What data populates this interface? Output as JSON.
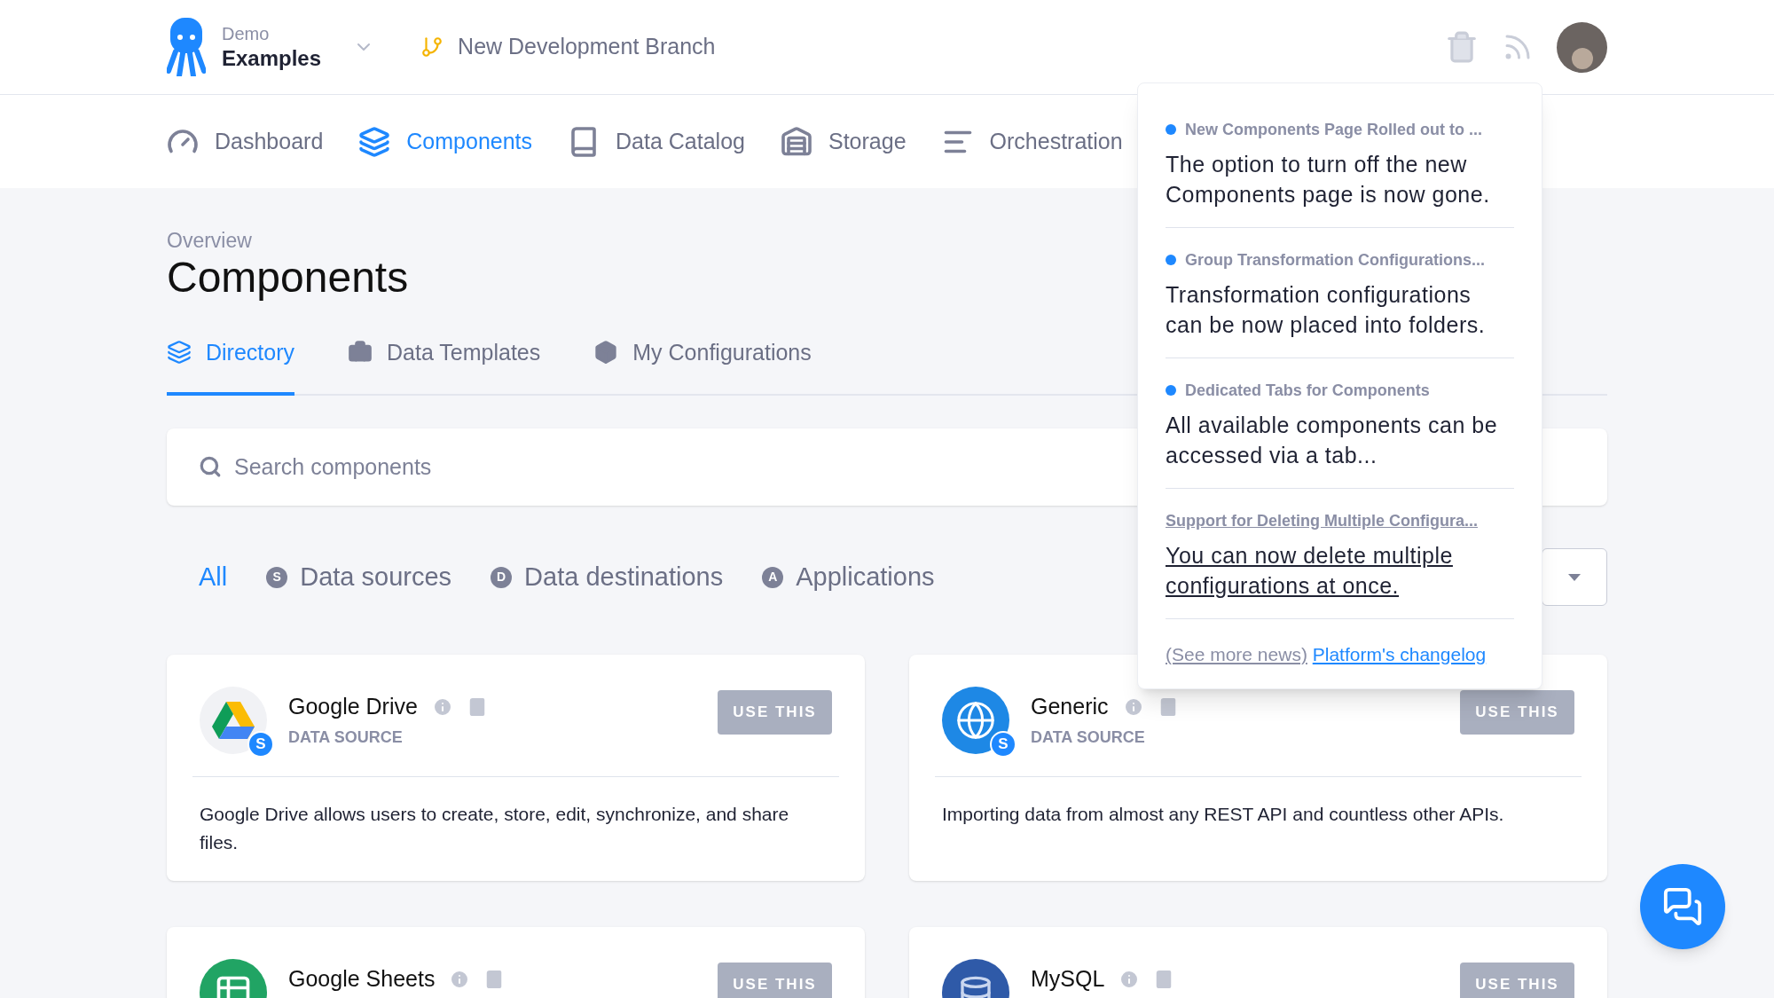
{
  "header": {
    "org": "Demo",
    "project": "Examples",
    "branch": "New Development Branch"
  },
  "nav": [
    {
      "label": "Dashboard",
      "selected": false
    },
    {
      "label": "Components",
      "selected": true
    },
    {
      "label": "Data Catalog",
      "selected": false
    },
    {
      "label": "Storage",
      "selected": false
    },
    {
      "label": "Orchestration",
      "selected": false
    }
  ],
  "page": {
    "breadcrumb": "Overview",
    "title": "Components"
  },
  "tabs": [
    {
      "label": "Directory",
      "selected": true
    },
    {
      "label": "Data Templates",
      "selected": false
    },
    {
      "label": "My Configurations",
      "selected": false
    }
  ],
  "search": {
    "placeholder": "Search components"
  },
  "filters": [
    {
      "label": "All",
      "selected": true
    },
    {
      "label": "Data sources",
      "badge": "S",
      "selected": false
    },
    {
      "label": "Data destinations",
      "badge": "D",
      "selected": false
    },
    {
      "label": "Applications",
      "badge": "A",
      "selected": false
    }
  ],
  "cards": [
    {
      "name": "Google Drive",
      "badge": "S",
      "type": "DATA SOURCE",
      "button": "USE THIS",
      "description": "Google Drive allows users to create, store, edit, synchronize, and share files."
    },
    {
      "name": "Generic",
      "badge": "S",
      "type": "DATA SOURCE",
      "button": "USE THIS",
      "description": "Importing data from almost any REST API and countless other APIs."
    },
    {
      "name": "Google Sheets",
      "button": "USE THIS"
    },
    {
      "name": "MySQL",
      "button": "USE THIS"
    }
  ],
  "news": {
    "items": [
      {
        "title": "New Components Page Rolled out to ...",
        "body": "The option to turn off the new Components page is now gone.",
        "unread": true,
        "hovered": false
      },
      {
        "title": "Group Transformation Configurations...",
        "body": "Transformation configurations can be now placed into folders.",
        "unread": true,
        "hovered": false
      },
      {
        "title": "Dedicated Tabs for Components",
        "body": "All available components can be accessed via a tab...",
        "unread": true,
        "hovered": false
      },
      {
        "title": "Support for Deleting Multiple Configura...",
        "body": "You can now delete multiple configurations at once.",
        "unread": false,
        "hovered": true
      }
    ],
    "more": "(See more news)",
    "link": "Platform's changelog"
  }
}
